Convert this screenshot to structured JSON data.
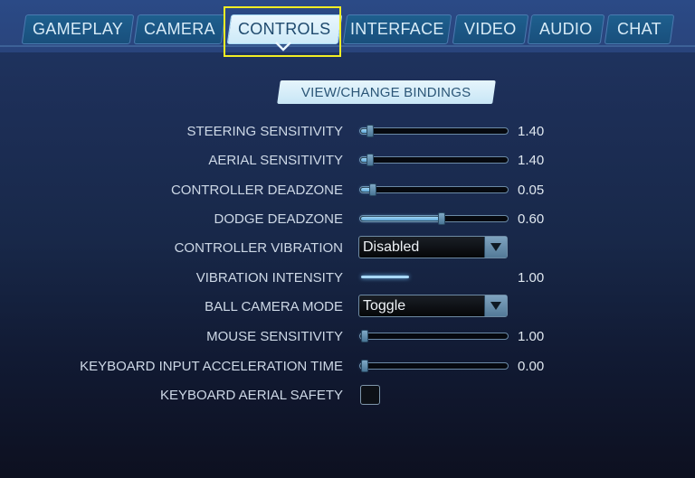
{
  "tabs": [
    {
      "label": "GAMEPLAY",
      "active": false
    },
    {
      "label": "CAMERA",
      "active": false
    },
    {
      "label": "CONTROLS",
      "active": true
    },
    {
      "label": "INTERFACE",
      "active": false
    },
    {
      "label": "VIDEO",
      "active": false
    },
    {
      "label": "AUDIO",
      "active": false
    },
    {
      "label": "CHAT",
      "active": false
    }
  ],
  "bindings_button": "VIEW/CHANGE BINDINGS",
  "settings": {
    "steering_sensitivity": {
      "label": "STEERING SENSITIVITY",
      "value": "1.40",
      "fraction": 0.04
    },
    "aerial_sensitivity": {
      "label": "AERIAL SENSITIVITY",
      "value": "1.40",
      "fraction": 0.04
    },
    "controller_deadzone": {
      "label": "CONTROLLER DEADZONE",
      "value": "0.05",
      "fraction": 0.06
    },
    "dodge_deadzone": {
      "label": "DODGE DEADZONE",
      "value": "0.60",
      "fraction": 0.55
    },
    "controller_vibration": {
      "label": "CONTROLLER VIBRATION",
      "selected": "Disabled"
    },
    "vibration_intensity": {
      "label": "VIBRATION INTENSITY",
      "value": "1.00"
    },
    "ball_camera_mode": {
      "label": "BALL CAMERA MODE",
      "selected": "Toggle"
    },
    "mouse_sensitivity": {
      "label": "MOUSE SENSITIVITY",
      "value": "1.00",
      "fraction": 0.0
    },
    "keyboard_input_acceleration_time": {
      "label": "KEYBOARD INPUT ACCELERATION TIME",
      "value": "0.00",
      "fraction": 0.0
    },
    "keyboard_aerial_safety": {
      "label": "KEYBOARD AERIAL SAFETY",
      "checked": false
    }
  },
  "icons": {
    "tab_indicator": "chevron-down-icon",
    "dropdown_arrow": "triangle-down-icon"
  }
}
